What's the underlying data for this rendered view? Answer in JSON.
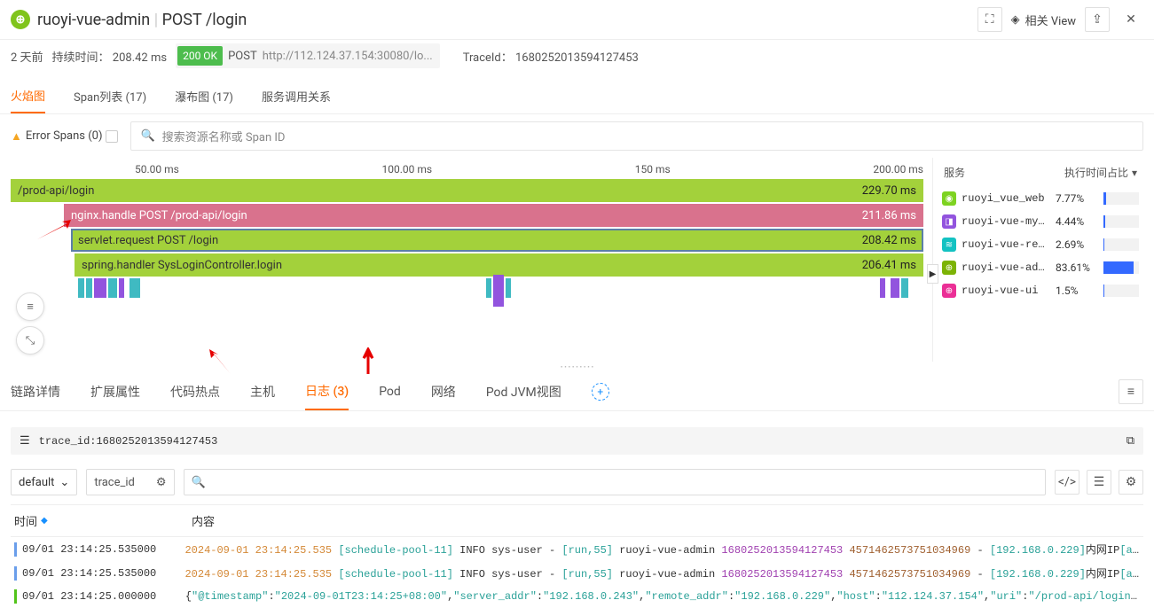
{
  "header": {
    "app_name": "ruoyi-vue-admin",
    "method": "POST",
    "path": "/login",
    "related_view": "相关 View"
  },
  "subhead": {
    "time_ago": "2 天前",
    "duration_label": "持续时间：",
    "duration": "208.42 ms",
    "status": "200 OK",
    "method": "POST",
    "url": "http://112.124.37.154:30080/lo...",
    "trace_label": "TraceId：",
    "trace_id": "1680252013594127453"
  },
  "tabs": [
    "火焰图",
    "Span列表 (17)",
    "瀑布图 (17)",
    "服务调用关系"
  ],
  "err_spans": "Error Spans (0)",
  "search_placeholder": "搜索资源名称或 Span ID",
  "ticks": [
    "50.00 ms",
    "100.00 ms",
    "150 ms",
    "200.00 ms"
  ],
  "spans": [
    {
      "label": "/prod-api/login",
      "dur": "229.70 ms"
    },
    {
      "label": "nginx.handle POST /prod-api/login",
      "dur": "211.86 ms"
    },
    {
      "label": "servlet.request POST /login",
      "dur": "208.42 ms"
    },
    {
      "label": "spring.handler SysLoginController.login",
      "dur": "206.41 ms"
    }
  ],
  "svc_head": {
    "name": "服务",
    "time": "执行时间占比"
  },
  "services": [
    {
      "icon_bg": "#7ed321",
      "name": "ruoyi_vue_web",
      "pct": "7.77%",
      "w": 3.2
    },
    {
      "icon_bg": "#9254de",
      "name": "ruoyi-vue-my...",
      "pct": "4.44%",
      "w": 1.8
    },
    {
      "icon_bg": "#13c2c2",
      "name": "ruoyi-vue-re...",
      "pct": "2.69%",
      "w": 1.1
    },
    {
      "icon_bg": "#7cb305",
      "name": "ruoyi-vue-ad...",
      "pct": "83.61%",
      "w": 33.5
    },
    {
      "icon_bg": "#eb2f96",
      "name": "ruoyi-vue-ui",
      "pct": "1.5%",
      "w": 0.6
    }
  ],
  "btabs": [
    "链路详情",
    "扩展属性",
    "代码热点",
    "主机",
    "日志 (3)",
    "Pod",
    "网络",
    "Pod JVM视图"
  ],
  "trace_q": {
    "key": "trace_id",
    "val": "1680252013594127453"
  },
  "def": "default",
  "chip": "trace_id",
  "log_th": {
    "time": "时间",
    "content": "内容"
  },
  "logs": [
    {
      "time": "09/01 23:14:25.535000",
      "ts": "2024-09-01 23:14:25.535",
      "thread": "[schedule-pool-11]",
      "level": "INFO",
      "logger": "sys-user",
      "run": "[run,55]",
      "svc": "ruoyi-vue-admin",
      "tid": "1680252013594127453",
      "sid": "4571462573751034969",
      "cons": "[192.168.0.229]",
      "tail": "内网IP",
      "ad": "[admin..."
    },
    {
      "time": "09/01 23:14:25.535000",
      "ts": "2024-09-01 23:14:25.535",
      "thread": "[schedule-pool-11]",
      "level": "INFO",
      "logger": "sys-user",
      "run": "[run,55]",
      "svc": "ruoyi-vue-admin",
      "tid": "1680252013594127453",
      "sid": "4571462573751034969",
      "cons": "[192.168.0.229]",
      "tail": "内网IP",
      "ad": "[admin..."
    },
    {
      "time": "09/01 23:14:25.000000",
      "raw": "{\"@timestamp\":\"2024-09-01T23:14:25+08:00\",\"server_addr\":\"192.168.0.243\",\"remote_addr\":\"192.168.0.229\",\"host\":\"112.124.37.154\",\"uri\":\"/prod-api/login\",\"b..."
    }
  ]
}
